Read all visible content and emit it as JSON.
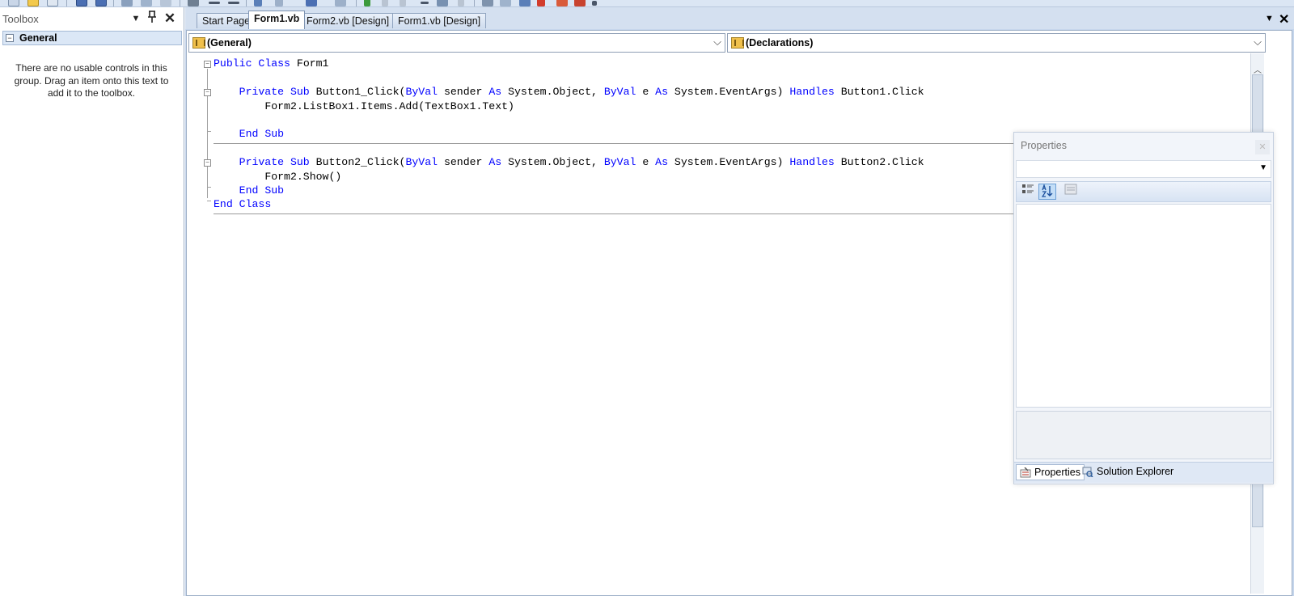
{
  "toolbox": {
    "title": "Toolbox",
    "group_label": "General",
    "group_toggle": "−",
    "empty_message": "There are no usable controls in this group. Drag an item onto this text to add it to the toolbox.",
    "menu_icon": "▼",
    "pin_icon": "Ꮧ",
    "close_icon": "✕"
  },
  "tabs": [
    {
      "label": "Start Page"
    },
    {
      "label": "Form1.vb"
    },
    {
      "label": "Form2.vb [Design]"
    },
    {
      "label": "Form1.vb [Design]"
    }
  ],
  "tab_controls": {
    "menu": "▼",
    "close": "✕"
  },
  "editor": {
    "class_combo": "(General)",
    "member_combo": "(Declarations)",
    "combo_arrow": "⌵"
  },
  "code": {
    "line1_kw1": "Public",
    "line1_kw2": "Class",
    "line1_name": "Form1",
    "line2_kw1": "Private",
    "line2_kw2": "Sub",
    "line2_sig": "Button1_Click(",
    "line2_byval1": "ByVal",
    "line2_sender": "sender",
    "line2_as1": "As",
    "line2_type1": "System.Object,",
    "line2_byval2": "ByVal",
    "line2_e": "e",
    "line2_as2": "As",
    "line2_type2": "System.EventArgs)",
    "line2_handles": "Handles",
    "line2_event": "Button1.Click",
    "line3": "Form2.ListBox1.Items.Add(TextBox1.Text)",
    "line4_kw1": "End",
    "line4_kw2": "Sub",
    "line5_kw1": "Private",
    "line5_kw2": "Sub",
    "line5_sig": "Button2_Click(",
    "line5_byval1": "ByVal",
    "line5_sender": "sender",
    "line5_as1": "As",
    "line5_type1": "System.Object,",
    "line5_byval2": "ByVal",
    "line5_e": "e",
    "line5_as2": "As",
    "line5_type2": "System.EventArgs)",
    "line5_handles": "Handles",
    "line5_event": "Button2.Click",
    "line6": "Form2.Show()",
    "line7_kw1": "End",
    "line7_kw2": "Sub",
    "line8_kw1": "End",
    "line8_kw2": "Class"
  },
  "properties": {
    "title": "Properties",
    "close": "✕",
    "combo_arrow": "▼",
    "tabs": [
      {
        "label": "Properties"
      },
      {
        "label": "Solution Explorer"
      }
    ]
  },
  "colors": {
    "keyword": "#0000ff",
    "tab_bg": "#d4e0f0",
    "toolbox_group_bg": "#dbe7f6"
  }
}
